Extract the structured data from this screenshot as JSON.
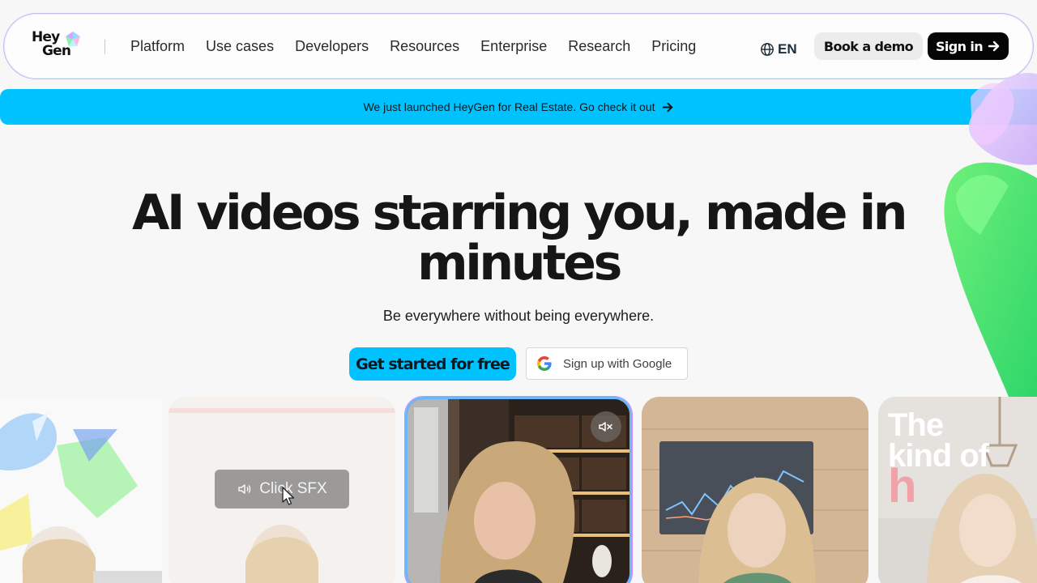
{
  "nav": {
    "logo": {
      "line1": "Hey",
      "line2": "Gen"
    },
    "menu": [
      "Platform",
      "Use cases",
      "Developers",
      "Resources",
      "Enterprise",
      "Research",
      "Pricing"
    ],
    "language": "EN",
    "book_demo": "Book a demo",
    "sign_in": "Sign in"
  },
  "banner": {
    "text": "We just launched HeyGen for Real Estate. Go check it out"
  },
  "hero": {
    "title": "AI videos starring you, made in minutes",
    "subtitle": "Be everywhere without being everywhere.",
    "cta_primary": "Get started for free",
    "cta_google": "Sign up with Google"
  },
  "cards": [
    {
      "overlay_label": "Click SFX",
      "icons": [
        "speaker-icon",
        "cursor-icon"
      ]
    },
    {
      "icons": [
        "mute-icon"
      ]
    },
    {
      "icons": []
    },
    {
      "overlay_text": {
        "line1": "The",
        "line2": "kind of",
        "line3": "h"
      }
    }
  ],
  "colors": {
    "accent_cyan": "#00c2ff",
    "text_dark": "#161616",
    "background": "#f7f7f7",
    "signin_bg": "#050505",
    "demo_bg": "#ececec"
  }
}
